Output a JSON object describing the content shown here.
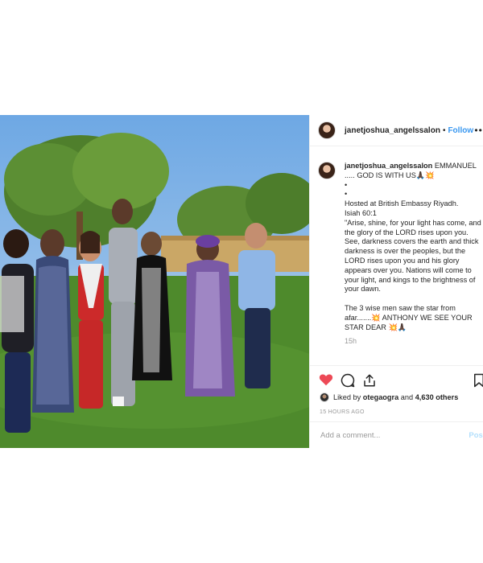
{
  "post": {
    "username": "janetjoshua_angelssalon",
    "follow_label": "Follow",
    "separator": "•",
    "more_label": "•••",
    "caption": "EMMANUEL ..... GOD IS WITH US🙏🏿💥\n•\n•\nHosted at British Embassy Riyadh.\nIsiah 60:1\n\"Arise, shine, for your light has come, and the glory of the LORD rises upon you. See, darkness covers the earth and thick darkness is over the peoples, but the LORD rises upon you and his glory appears over you. Nations will come to your light, and kings to the brightness of your dawn.\n\nThe 3 wise men saw the star from afar.......💥 ANTHONY WE SEE YOUR STAR DEAR 💥🙏🏿",
    "caption_age": "15h",
    "liked_by_prefix": "Liked by",
    "liked_by_user": "otegaogra",
    "liked_by_and": "and",
    "likes_count": "4,630 others",
    "timestamp": "15 HOURS AGO",
    "comment_placeholder": "Add a comment...",
    "post_button": "Post"
  },
  "icons": {
    "like": "heart-icon",
    "comment": "comment-icon",
    "share": "share-icon",
    "save": "bookmark-icon"
  },
  "colors": {
    "like": "#ed4956",
    "link": "#3897f0",
    "muted": "#999999"
  }
}
